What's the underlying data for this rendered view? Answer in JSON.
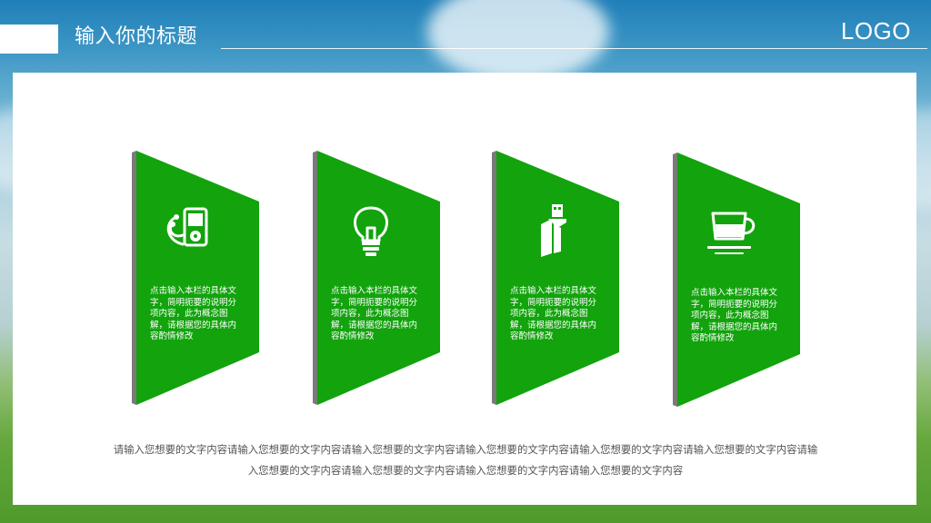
{
  "header": {
    "title": "输入你的标题",
    "logo": "LOGO"
  },
  "colors": {
    "card_green": "#12a30d",
    "card_edge": "#7a7a7a",
    "text_gray": "#555555"
  },
  "cards": [
    {
      "icon": "music-player-icon",
      "text": "点击输入本栏的具体文字，简明扼要的说明分项内容，此为概念图解，请根据您的具体内容酌情修改"
    },
    {
      "icon": "light-bulb-icon",
      "text": "点击输入本栏的具体文字，简明扼要的说明分项内容，此为概念图解，请根据您的具体内容酌情修改"
    },
    {
      "icon": "usb-drive-icon",
      "text": "点击输入本栏的具体文字，简明扼要的说明分项内容，此为概念图解，请根据您的具体内容酌情修改"
    },
    {
      "icon": "coffee-cup-icon",
      "text": "点击输入本栏的具体文字，简明扼要的说明分项内容，此为概念图解，请根据您的具体内容酌情修改"
    }
  ],
  "body_text": "请输入您想要的文字内容请输入您想要的文字内容请输入您想要的文字内容请输入您想要的文字内容请输入您想要的文字内容请输入您想要的文字内容请输入您想要的文字内容请输入您想要的文字内容请输入您想要的文字内容请输入您想要的文字内容"
}
